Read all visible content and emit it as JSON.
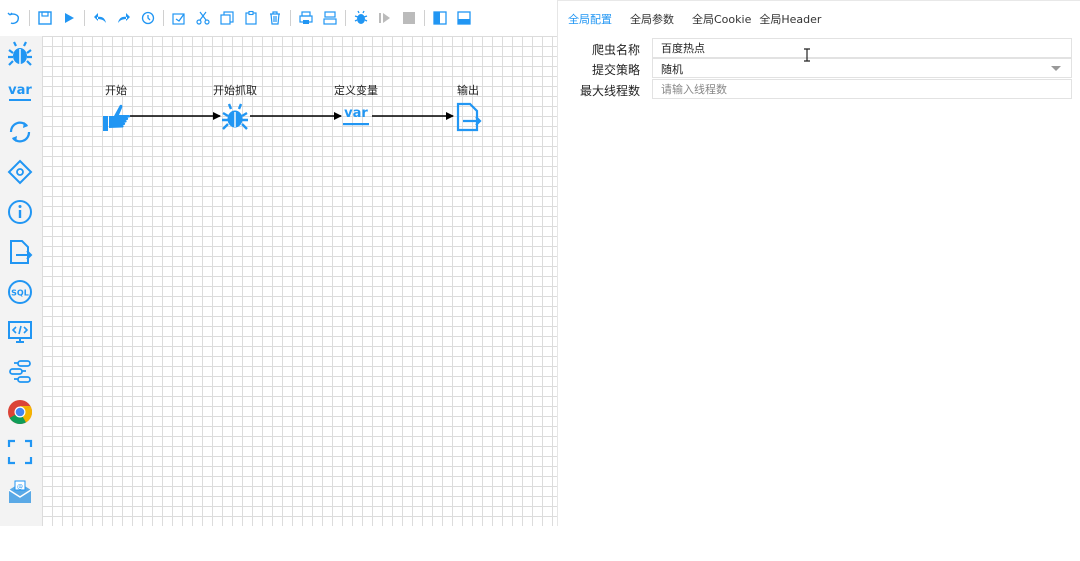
{
  "colors": {
    "accent": "#2196f3",
    "grid": "#dcdcdc",
    "palette_bg": "#f3f3f3"
  },
  "toolbar": {
    "buttons": [
      {
        "name": "undo-icon"
      },
      {
        "name": "save-icon"
      },
      {
        "name": "play-icon"
      },
      {
        "name": "back-icon"
      },
      {
        "name": "redo-icon"
      },
      {
        "name": "history-icon"
      },
      {
        "name": "select-icon"
      },
      {
        "name": "cut-icon"
      },
      {
        "name": "copy-icon"
      },
      {
        "name": "paste-icon"
      },
      {
        "name": "delete-icon"
      },
      {
        "name": "print-icon"
      },
      {
        "name": "print-setup-icon"
      },
      {
        "name": "debug-icon"
      },
      {
        "name": "step-icon"
      },
      {
        "name": "stop-icon"
      },
      {
        "name": "panel-left-icon"
      },
      {
        "name": "panel-bottom-icon"
      }
    ]
  },
  "palette": [
    {
      "name": "spider-icon"
    },
    {
      "name": "variable-icon"
    },
    {
      "name": "loop-icon"
    },
    {
      "name": "condition-icon"
    },
    {
      "name": "info-icon"
    },
    {
      "name": "output-icon"
    },
    {
      "name": "sql-icon"
    },
    {
      "name": "code-icon"
    },
    {
      "name": "process-icon"
    },
    {
      "name": "chrome-icon"
    },
    {
      "name": "screenshot-icon"
    },
    {
      "name": "mail-icon"
    }
  ],
  "flow": {
    "nodes": [
      {
        "label": "开始",
        "icon": "thumb-icon"
      },
      {
        "label": "开始抓取",
        "icon": "spider-icon"
      },
      {
        "label": "定义变量",
        "icon": "variable-icon"
      },
      {
        "label": "输出",
        "icon": "output-icon"
      }
    ]
  },
  "props": {
    "tabs": [
      "全局配置",
      "全局参数",
      "全局Cookie",
      "全局Header"
    ],
    "fields": {
      "name": {
        "label": "爬虫名称",
        "value": "百度热点"
      },
      "strategy": {
        "label": "提交策略",
        "value": "随机"
      },
      "threads": {
        "label": "最大线程数",
        "value": "",
        "placeholder": "请输入线程数"
      }
    }
  },
  "var_text": "var"
}
